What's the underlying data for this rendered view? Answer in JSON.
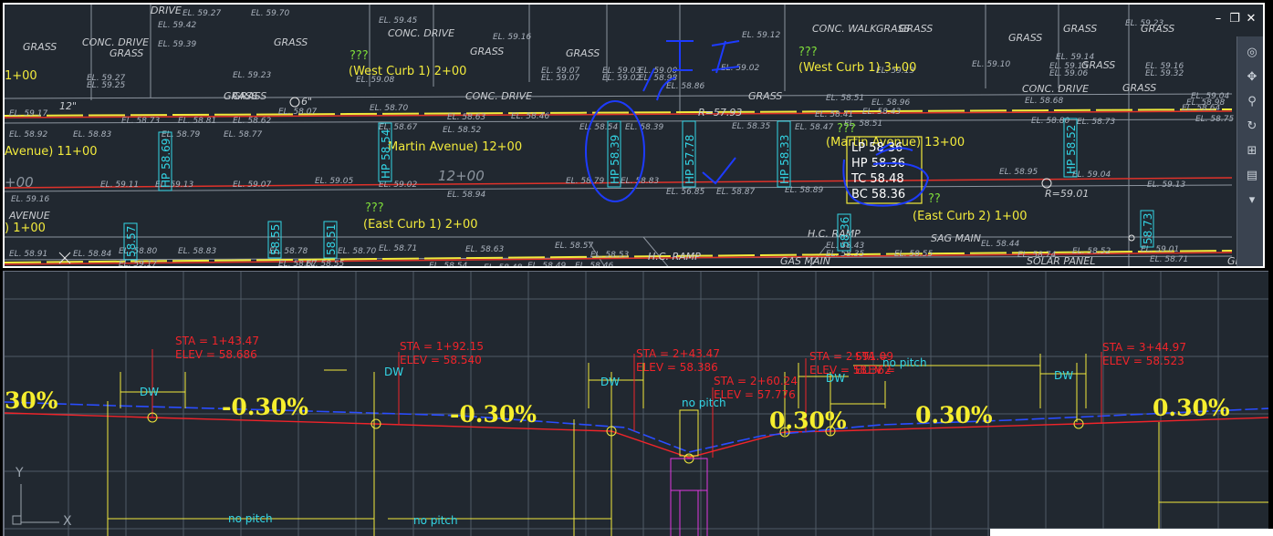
{
  "colors": {
    "background": "#212830",
    "street_line": "#e8e8e8",
    "curb_yellow": "#f2ea3c",
    "station_cyan": "#33d6e6",
    "markup_blue": "#1d3bff",
    "profile_red": "#f0242a",
    "profile_blue": "#2a4dff"
  },
  "window_controls": {
    "minimize": "–",
    "restore": "❐",
    "close": "✕"
  },
  "plan": {
    "labels_white": [
      "EL. 59.27",
      "EL. 59.45",
      "EL. 59.70",
      "EL. 59.42",
      "EL. 59.39",
      "EL. 59.23",
      "EL. 59.27",
      "EL. 59.25",
      "EL. 59.16",
      "EL. 59.12",
      "EL. 59.07",
      "EL. 59.03",
      "EL. 59.07",
      "EL. 59.02",
      "EL. 59.00",
      "EL. 58.98",
      "EL. 58.86",
      "EL. 59.02",
      "EL. 59.08",
      "EL. 59.23",
      "EL. 59.13",
      "EL. 59.14",
      "EL. 59.10",
      "EL. 59.15",
      "EL. 59.06",
      "EL. 59.16",
      "EL. 59.32",
      "EL. 59.04",
      "EL. 58.98",
      "EL. 58.96",
      "EL. 58.51",
      "EL. 58.43",
      "EL. 59.17",
      "EL. 58.92",
      "EL. 58.73",
      "EL. 58.81",
      "EL. 58.83",
      "EL. 58.79",
      "EL. 58.62",
      "EL. 58.77",
      "EL. 58.07",
      "EL. 58.70",
      "EL. 58.67",
      "EL. 58.63",
      "EL. 58.52",
      "EL. 58.46",
      "EL. 58.54",
      "EL. 58.39",
      "EL. 58.35",
      "EL. 58.47",
      "EL. 58.51",
      "EL. 58.41",
      "EL. 58.68",
      "EL. 58.80",
      "EL. 58.73",
      "EL. 58.64",
      "EL. 58.75",
      "EL. 59.11",
      "EL. 59.13",
      "EL. 59.07",
      "EL. 59.05",
      "EL. 59.02",
      "EL. 58.94",
      "EL. 58.79",
      "EL. 58.83",
      "EL. 56.85",
      "EL. 58.87",
      "EL. 58.89",
      "EL. 58.95",
      "EL. 59.04",
      "EL. 59.13",
      "EL. 59.16",
      "EL. 58.91",
      "EL. 58.84",
      "EL. 58.80",
      "EL. 58.83",
      "EL. 58.78",
      "EL. 58.70",
      "EL. 58.71",
      "EL. 58.63",
      "EL. 58.57",
      "EL. 58.53",
      "EL. 58.46",
      "EL. 58.43",
      "EL. 58.35",
      "EL. 58.55",
      "EL. 58.44",
      "EL. 58.74",
      "EL. 58.52",
      "EL. 59.01",
      "EL. 58.71",
      "EL. 59.17",
      "EL. 58.67",
      "EL. 58.55",
      "EL. 58.54",
      "EL. 58.48",
      "EL. 58.49",
      "EL. 58.58"
    ],
    "labels_text": [
      "GRASS",
      "DRIVE",
      "CONC. DRIVE",
      "GRASS",
      "GRASS",
      "GRASS",
      "CONC. DRIVE",
      "GRASS",
      "GRASS",
      "CONC. DRIVE",
      "GRASS",
      "GRASS",
      "GRASS",
      "GRASS",
      "GRASS",
      "CONC. DRIVE",
      "CONC. WALK",
      "GRASS",
      "GRASS",
      "GRASS",
      "GRASS",
      "GRASS",
      "AVENUE",
      "GAS MAIN",
      "H.C. RAMP",
      "H.C. RAMP",
      "SAG MAIN",
      "SOLAR PANEL",
      "12\"",
      "6\"",
      "R=57.93",
      "R=59.01"
    ],
    "stations": [
      "1+00",
      "Avenue) 11+00",
      "12+00",
      "(West Curb 1) 2+00",
      "(West Curb 1) 3+00",
      "Martin Avenue) 12+00",
      "(Martin Avenue) 13+00",
      "(East Curb 1) 2+00",
      "(East Curb 2) 1+00",
      ") 1+00",
      "+00",
      "(We"
    ],
    "qmarks": [
      "???",
      "???",
      "???",
      "???",
      "??"
    ],
    "points": [
      "HP 58.69",
      "HP 58.54",
      "HP 58.39",
      "HP 57.78",
      "HP 58.33",
      "HP 58.52",
      "58.57",
      "58.55",
      "58.51",
      "58.36",
      "58.73"
    ],
    "callout": [
      "LP 58.36",
      "HP 58.36",
      "TC 58.48",
      "BC 58.36"
    ]
  },
  "profile": {
    "pvis": [
      {
        "sta": "STA = 1+43.47",
        "elev": "ELEV =  58.686"
      },
      {
        "sta": "STA = 1+92.15",
        "elev": "ELEV =  58.540"
      },
      {
        "sta": "STA = 2+43.47",
        "elev": "ELEV =  58.386"
      },
      {
        "sta": "STA = 2+60.24",
        "elev": "ELEV =  57.776"
      },
      {
        "sta": "STA = 2+91.09",
        "elev": "ELEV =  58.362"
      },
      {
        "sta": "STA = 3+44.97",
        "elev": "ELEV =  58.523"
      }
    ],
    "extra_sta": "STA =",
    "extra_elev": "ELEV =",
    "slopes": [
      "30%",
      "-0.30%",
      "-0.30%",
      "0.30%",
      "0.30%",
      "0.30%"
    ],
    "dw": "DW",
    "no_pitch": "no pitch",
    "ucs_x": "X",
    "ucs_y": "Y"
  }
}
